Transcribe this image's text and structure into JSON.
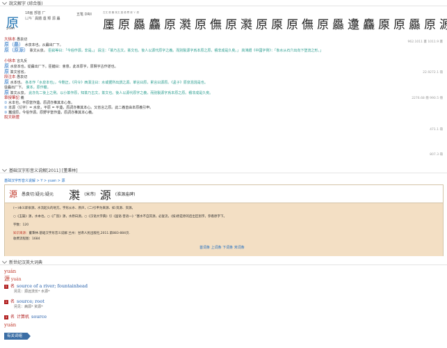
{
  "section1": {
    "title": "說文解字 (綜合版)"
  },
  "head": {
    "char": "原",
    "pinyin": "yuán",
    "meta_row1": "18画  部首  厂",
    "meta_row2": "ㄩㄢˊ  異體  邍 羱 源 厵",
    "meta_extra": "五笔 DRII",
    "variants_caption": "古文 原 厵 篆文 邍 源 麖 厡 ㄚ 原"
  },
  "glyphs": [
    "㕓",
    "原",
    "厵",
    "麤",
    "原",
    "㶋",
    "原",
    "㒇",
    "原",
    "㶋",
    "原",
    "厡",
    "原",
    "㒇",
    "原",
    "厵",
    "邍",
    "麤",
    "厡",
    "原",
    "厵",
    "原",
    "源"
  ],
  "shuowen": {
    "tag1": "大徐本",
    "tag1_pron": "愚袁切",
    "main1": "原（厵）",
    "main1_def": "水泉本也。从灥出厂下。",
    "main2": "原（原源）",
    "main2_def": "篆文从泉。",
    "note_label": "臣鉉等曰：",
    "note": "「今俗作源，非是。」 段注：「篆乃古文，篆文也。後人以源代原字之義。而別製源字爲本原之原，積非成是久矣。」 高鴻縉《中國字例》：「象水从石穴出向下墜流之形。」",
    "tag2": "小徐本",
    "tag2_pron": "言丸反",
    "small1": "水泉本也。從灥出厂下。臣鍇曰：會意。此本原字，原隰字古作遂也。",
    "small2": "篆文省省。",
    "tag3": "段注本",
    "tag3_pron": "愚袁切",
    "duan1": "水本也。",
    "duan1_note": "各本作「水泉本也」，今刪正。《月令》西漢注曰：水或据所出謂之源。單言曰原，累言曰源原。《孟子》原泉混混是也。",
    "duan2": "從灥出厂下。",
    "duan2_note": "廣本，原作蘗。",
    "duan3": "篆文从泉。",
    "duan3_note": "此亦先二後上之例。以小篆作原，知篆乃古文，篆文也。後人以源代原字之義，而別製源字爲本原之原。積非成是久矣。",
    "tag4": "章授筆記",
    "tag4_pron": "義",
    "notes": [
      "水本也，平原當作邍。原詞亦推其本心象。",
      "本源（衍字）= 水泉，平原 = 平邍，原詞亦推其本心。又省言之原。此二義皆由本原義引申。",
      "蠶成原，今俗作源。原野字當作邍，原詞亦推其本心義。"
    ],
    "tag5": "說文新證",
    "nums": [
      "962.1011 畫",
      "22.9272.1 冊",
      "2276.68 冊",
      "471.1 冊",
      "807.3 冊"
    ],
    "nums2": [
      "1011.9 畫",
      "990.5 冊"
    ]
  },
  "section2": {
    "title": "基础汉字形音义说解[2011] [董秉林]"
  },
  "breadcrumb": "基础汉字形音义说解 > Y > yuan > 源",
  "panel": {
    "char": "源",
    "pron": "愚袁切:疑元:疑元",
    "glyph1": "㶋",
    "glyph1_note": "(米芾)",
    "glyph2": "源",
    "glyph2_note": "(淮源庙碑)",
    "line1": "(一)本义即泉源，水流起头的地方。字形从水、原声，(二)引申为来源、如:资源、资源。",
    "line2": "○《玉篇》源，水本也。○《广韵》源，水原曰源。○《汉语大字典》引《国语·晋语一》“塞水不自其源，必复流，(按)原是原的后出区别字。参看原字下。",
    "line3": "字数：120",
    "src_label": "知识来源：",
    "src": "董秉林.基础汉字形音义说解.兰州：甘肃人民出版社,2011.第883-884页.",
    "src2": "收费流程图：1684",
    "links": "首词条 上词条 下词条 末词条"
  },
  "section3": {
    "title": "新世纪汉英大词典"
  },
  "dict": {
    "pinyin1": "yuán",
    "char": "源",
    "pinyin_sub": "yuán",
    "entries": [
      {
        "num": "1",
        "pos": "名",
        "def": "source of a river; fountainhead",
        "sub": "另见：源远流长*  水源*"
      },
      {
        "num": "2",
        "pos": "名",
        "def": "source; root",
        "sub": "另见：病源*  资源*"
      },
      {
        "num": "3",
        "pos": "名",
        "extra": "计算机",
        "def": "source",
        "sub": ""
      }
    ],
    "pinyin2": "yuán",
    "related": "有关词组"
  }
}
